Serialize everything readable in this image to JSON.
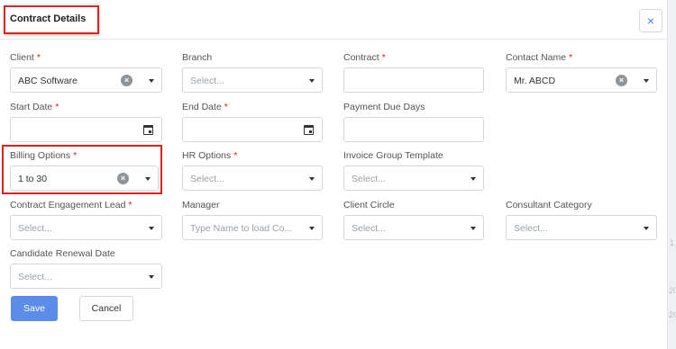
{
  "header": {
    "title": "Contract Details",
    "close_icon": "×"
  },
  "required_marker": "*",
  "clear_icon": "×",
  "fields": {
    "client": {
      "label": "Client",
      "value": "ABC Software"
    },
    "branch": {
      "label": "Branch",
      "placeholder": "Select..."
    },
    "contract": {
      "label": "Contract",
      "value": ""
    },
    "contact_name": {
      "label": "Contact Name",
      "value": "Mr. ABCD"
    },
    "start_date": {
      "label": "Start Date",
      "value": ""
    },
    "end_date": {
      "label": "End Date",
      "value": ""
    },
    "payment_due_days": {
      "label": "Payment Due Days",
      "value": ""
    },
    "billing_options": {
      "label": "Billing Options",
      "value": "1 to 30"
    },
    "hr_options": {
      "label": "HR Options",
      "placeholder": "Select..."
    },
    "invoice_group_template": {
      "label": "Invoice Group Template",
      "placeholder": "Select..."
    },
    "contract_engagement_lead": {
      "label": "Contract Engagement Lead",
      "placeholder": "Select..."
    },
    "manager": {
      "label": "Manager",
      "placeholder": "Type Name to load Co..."
    },
    "client_circle": {
      "label": "Client Circle",
      "placeholder": "Select..."
    },
    "consultant_category": {
      "label": "Consultant Category",
      "placeholder": "Select..."
    },
    "candidate_renewal_date": {
      "label": "Candidate Renewal Date",
      "placeholder": "Select..."
    }
  },
  "buttons": {
    "save": "Save",
    "cancel": "Cancel"
  },
  "background": {
    "texts": [
      "1",
      "20",
      "20"
    ]
  },
  "colors": {
    "required": "#e0201d",
    "highlight": "#e0201d",
    "primary": "#5b8de8",
    "close": "#4a7fd6"
  }
}
